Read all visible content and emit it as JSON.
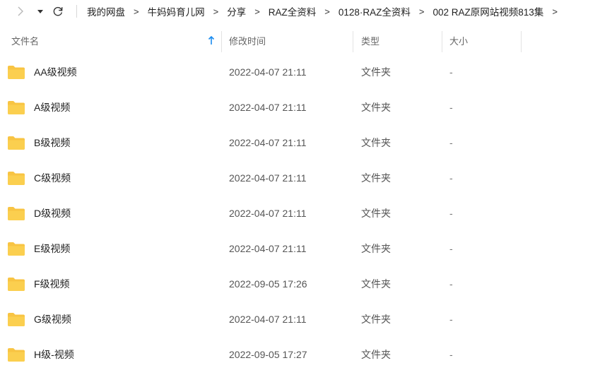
{
  "toolbar": {
    "forward_icon": "chevron-right-icon",
    "dropdown_icon": "caret-down-icon",
    "refresh_icon": "refresh-icon"
  },
  "breadcrumb": [
    "我的网盘",
    "牛妈妈育儿网",
    "分享",
    "RAZ全资料",
    "0128·RAZ全资料",
    "002 RAZ原网站视频813集"
  ],
  "breadcrumb_sep": ">",
  "columns": {
    "name": "文件名",
    "modified": "修改时间",
    "type": "类型",
    "size": "大小"
  },
  "sort_icon": "arrow-up-icon",
  "accent": "#1a8cf0",
  "folder_color": "#f8c443",
  "files": [
    {
      "name": "AA级视频",
      "modified": "2022-04-07 21:11",
      "type": "文件夹",
      "size": "-"
    },
    {
      "name": "A级视频",
      "modified": "2022-04-07 21:11",
      "type": "文件夹",
      "size": "-"
    },
    {
      "name": "B级视频",
      "modified": "2022-04-07 21:11",
      "type": "文件夹",
      "size": "-"
    },
    {
      "name": "C级视频",
      "modified": "2022-04-07 21:11",
      "type": "文件夹",
      "size": "-"
    },
    {
      "name": "D级视频",
      "modified": "2022-04-07 21:11",
      "type": "文件夹",
      "size": "-"
    },
    {
      "name": "E级视频",
      "modified": "2022-04-07 21:11",
      "type": "文件夹",
      "size": "-"
    },
    {
      "name": "F级视频",
      "modified": "2022-09-05 17:26",
      "type": "文件夹",
      "size": "-"
    },
    {
      "name": "G级视频",
      "modified": "2022-04-07 21:11",
      "type": "文件夹",
      "size": "-"
    },
    {
      "name": "H级-视频",
      "modified": "2022-09-05 17:27",
      "type": "文件夹",
      "size": "-"
    }
  ]
}
